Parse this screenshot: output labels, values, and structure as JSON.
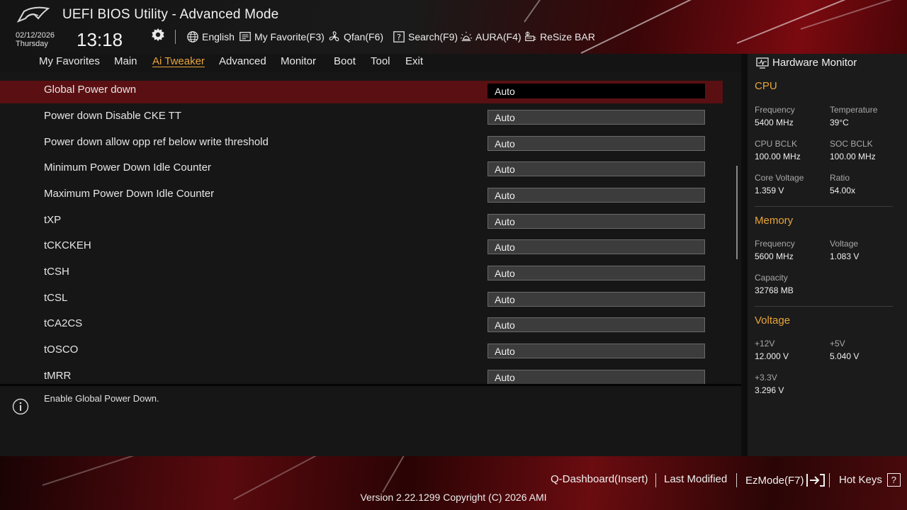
{
  "header": {
    "title": "UEFI BIOS Utility - Advanced Mode",
    "date": "02/12/2026",
    "weekday": "Thursday",
    "time": "13:18",
    "tools": {
      "language": "English",
      "favorite": "My Favorite(F3)",
      "qfan": "Qfan(F6)",
      "search": "Search(F9)",
      "aura": "AURA(F4)",
      "resize_bar": "ReSize BAR"
    }
  },
  "nav": {
    "tabs": [
      "My Favorites",
      "Main",
      "Ai Tweaker",
      "Advanced",
      "Monitor",
      "Boot",
      "Tool",
      "Exit"
    ],
    "active": "Ai Tweaker"
  },
  "settings": [
    {
      "label": "Global Power down",
      "value": "Auto"
    },
    {
      "label": "Power down Disable CKE TT",
      "value": "Auto"
    },
    {
      "label": "Power down allow opp ref below write threshold",
      "value": "Auto"
    },
    {
      "label": "Minimum Power Down Idle Counter",
      "value": "Auto"
    },
    {
      "label": "Maximum Power Down Idle Counter",
      "value": "Auto"
    },
    {
      "label": "tXP",
      "value": "Auto"
    },
    {
      "label": "tCKCKEH",
      "value": "Auto"
    },
    {
      "label": "tCSH",
      "value": "Auto"
    },
    {
      "label": "tCSL",
      "value": "Auto"
    },
    {
      "label": "tCA2CS",
      "value": "Auto"
    },
    {
      "label": "tOSCO",
      "value": "Auto"
    },
    {
      "label": "tMRR",
      "value": "Auto"
    }
  ],
  "help": {
    "text": "Enable Global Power Down."
  },
  "hwmon": {
    "title": "Hardware Monitor",
    "cpu": {
      "heading": "CPU",
      "frequency_label": "Frequency",
      "frequency": "5400 MHz",
      "temperature_label": "Temperature",
      "temperature": "39°C",
      "bclk_label": "CPU BCLK",
      "bclk": "100.00 MHz",
      "soc_bclk_label": "SOC BCLK",
      "soc_bclk": "100.00 MHz",
      "core_voltage_label": "Core Voltage",
      "core_voltage": "1.359 V",
      "ratio_label": "Ratio",
      "ratio": "54.00x"
    },
    "memory": {
      "heading": "Memory",
      "frequency_label": "Frequency",
      "frequency": "5600 MHz",
      "voltage_label": "Voltage",
      "voltage": "1.083 V",
      "capacity_label": "Capacity",
      "capacity": "32768 MB"
    },
    "voltage": {
      "heading": "Voltage",
      "v12_label": "+12V",
      "v12": "12.000 V",
      "v5_label": "+5V",
      "v5": "5.040 V",
      "v33_label": "+3.3V",
      "v33": "3.296 V"
    }
  },
  "footer": {
    "qdashboard": "Q-Dashboard(Insert)",
    "last_modified": "Last Modified",
    "ezmode": "EzMode(F7)",
    "hotkeys": "Hot Keys",
    "hotkeys_key": "?",
    "version": "Version 2.22.1299 Copyright (C) 2026 AMI"
  },
  "colors": {
    "accent": "#e8a53a",
    "selected_row": "#5a1012",
    "brand_red": "#7a0a10"
  },
  "icons": [
    "rog-logo-icon",
    "gear-icon",
    "globe-icon",
    "favorite-icon",
    "fan-icon",
    "search-icon",
    "aura-icon",
    "resize-bar-icon",
    "info-icon",
    "hardware-monitor-icon",
    "ezmode-exit-icon"
  ]
}
